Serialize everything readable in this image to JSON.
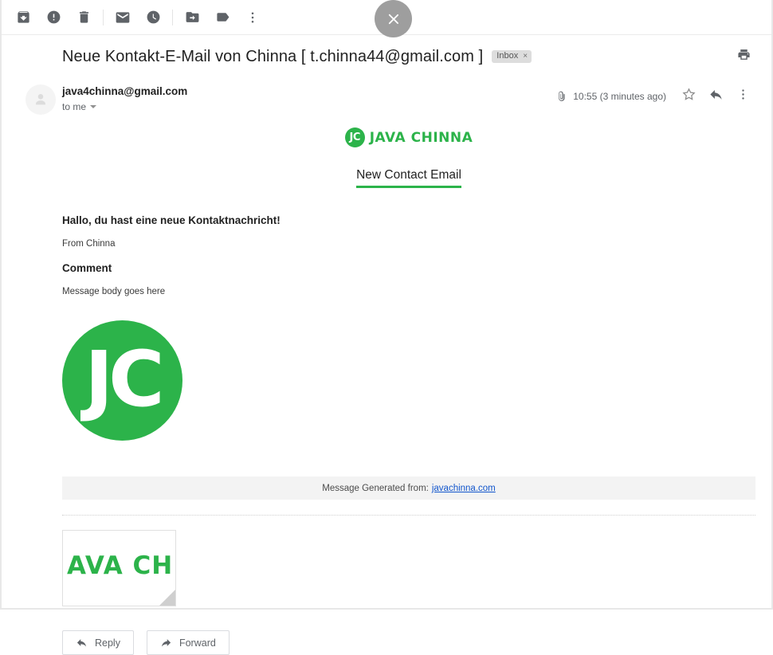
{
  "toolbar": {
    "buttons": [
      {
        "name": "archive-icon",
        "label": "Archive"
      },
      {
        "name": "report-spam-icon",
        "label": "Report spam"
      },
      {
        "name": "delete-icon",
        "label": "Delete"
      },
      {
        "name": "mark-unread-icon",
        "label": "Mark as unread"
      },
      {
        "name": "snooze-icon",
        "label": "Snooze"
      },
      {
        "name": "move-to-icon",
        "label": "Move to"
      },
      {
        "name": "labels-icon",
        "label": "Labels"
      },
      {
        "name": "more-icon",
        "label": "More"
      }
    ],
    "close_label": "Close",
    "print_label": "Print all"
  },
  "header": {
    "subject": "Neue Kontakt-E-Mail von Chinna [ t.chinna44@gmail.com ]",
    "label_chip": "Inbox",
    "label_chip_remove": "×"
  },
  "sender": {
    "email": "java4chinna@gmail.com",
    "recipient": "to me",
    "timestamp": "10:55 (3 minutes ago)",
    "star_label": "Star",
    "reply_label": "Reply",
    "more_label": "More"
  },
  "message": {
    "brand_mark": "JC",
    "brand_name": "JAVA CHINNA",
    "heading": "New Contact Email",
    "greeting": "Hallo, du hast eine neue Kontaktnachricht!",
    "from_line": "From Chinna",
    "comment_head": "Comment",
    "comment_body": "Message body goes here",
    "big_logo_text": "JC",
    "generated_prefix": "Message Generated from:",
    "generated_link": "javachinna.com"
  },
  "attachment": {
    "thumb_text": "AVA CH",
    "alt": "javachinna logo image attachment"
  },
  "actions": {
    "reply": "Reply",
    "forward": "Forward"
  },
  "colors": {
    "brand_green": "#2cb34a",
    "link_blue": "#1155cc",
    "icon_gray": "#5f6368",
    "close_gray": "#9e9e9e"
  }
}
